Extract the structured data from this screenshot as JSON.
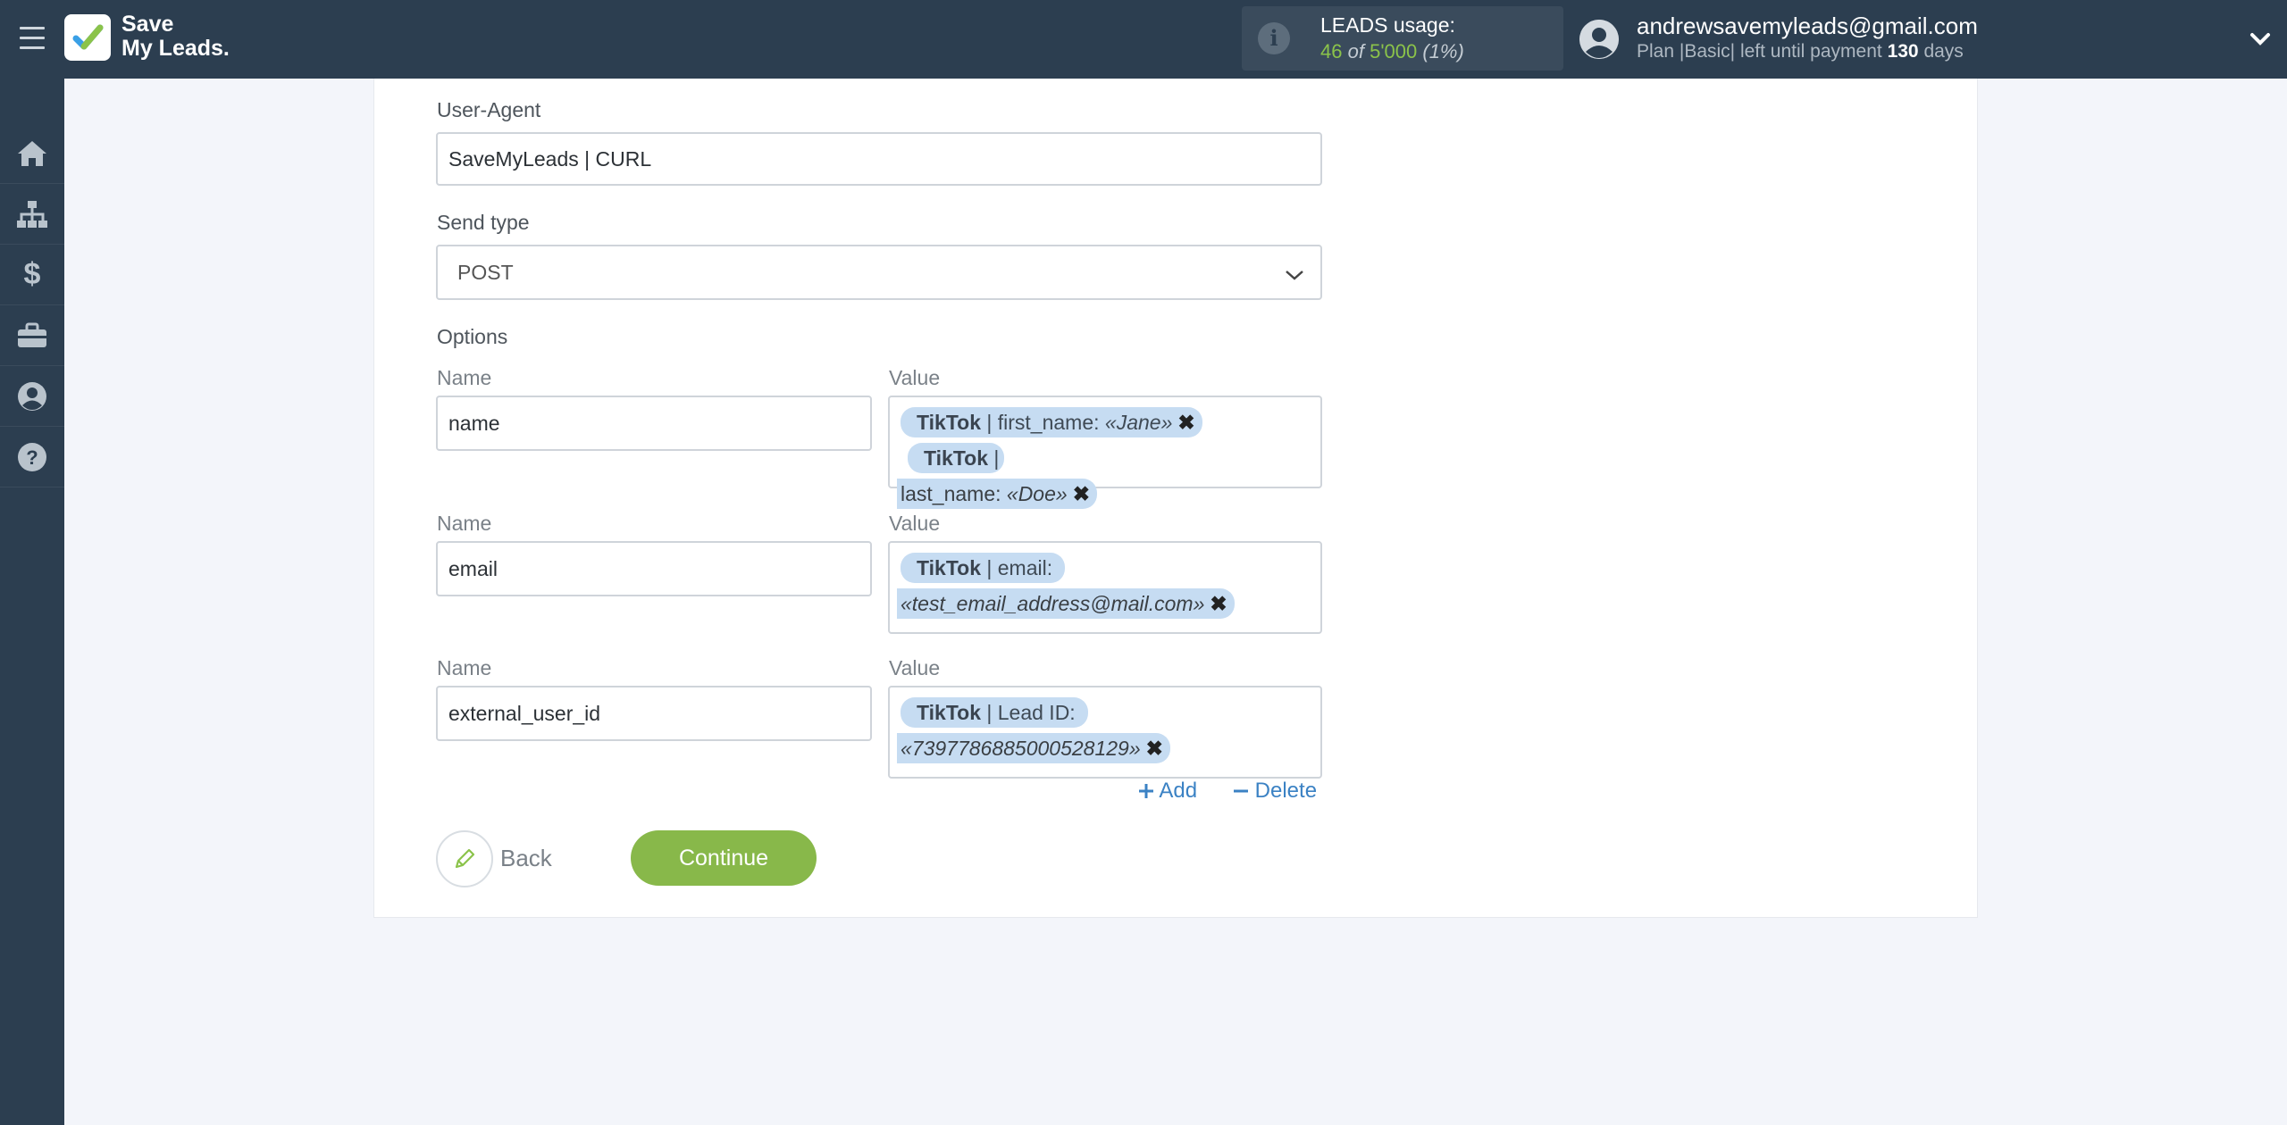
{
  "header": {
    "logo_line1": "Save",
    "logo_line2": "My Leads.",
    "leads_title": "LEADS usage:",
    "leads_used": "46",
    "leads_of": "of",
    "leads_total": "5'000",
    "leads_percent": "(1%)",
    "user_email": "andrewsavemyleads@gmail.com",
    "plan_text": "Plan |Basic| left until payment",
    "plan_days": "130",
    "plan_days_unit": "days"
  },
  "sidebar": {
    "items": [
      "home-icon",
      "sitemap-icon",
      "dollar-icon",
      "briefcase-icon",
      "user-circle-icon",
      "help-icon"
    ]
  },
  "form": {
    "user_agent_label": "User-Agent",
    "user_agent_value": "SaveMyLeads | CURL",
    "send_type_label": "Send type",
    "send_type_value": "POST",
    "options_label": "Options",
    "name_label": "Name",
    "value_label": "Value",
    "rows": [
      {
        "name": "name",
        "tags": [
          {
            "source": "TikTok",
            "field": "| first_name:",
            "value": "«Jane»",
            "close": "✖"
          },
          {
            "source": "TikTok",
            "field": "|",
            "field2": "last_name:",
            "value": "«Doe»",
            "close": "✖"
          }
        ]
      },
      {
        "name": "email",
        "tags": [
          {
            "source": "TikTok",
            "field": "| email:",
            "value": "«test_email_address@mail.com»",
            "close": "✖"
          }
        ]
      },
      {
        "name": "external_user_id",
        "tags": [
          {
            "source": "TikTok",
            "field": "| Lead ID:",
            "value": "«7397786885000528129»",
            "close": "✖"
          }
        ]
      }
    ],
    "add_label": "Add",
    "delete_label": "Delete",
    "back_label": "Back",
    "continue_label": "Continue"
  },
  "colors": {
    "topbar": "#2c3e50",
    "accent_green": "#88b84a",
    "tag_blue": "#c6dcf2",
    "link_blue": "#3b82c4"
  }
}
